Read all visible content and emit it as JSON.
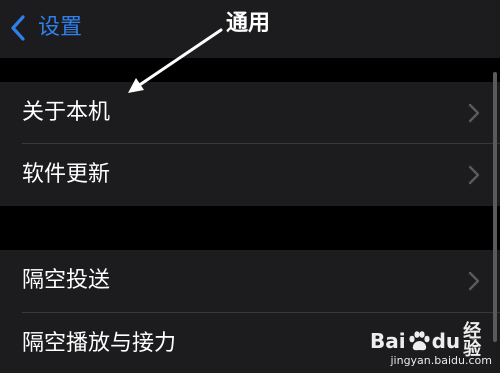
{
  "nav": {
    "back_label": "设置",
    "title": "通用"
  },
  "groups": [
    {
      "items": [
        {
          "label": "关于本机",
          "has_chevron": true
        },
        {
          "label": "软件更新",
          "has_chevron": true
        }
      ]
    },
    {
      "items": [
        {
          "label": "隔空投送",
          "has_chevron": true
        },
        {
          "label": "隔空播放与接力",
          "has_chevron": true
        }
      ]
    }
  ],
  "watermark": {
    "brand_prefix": "Bai",
    "brand_du": "du",
    "brand_suffix": "经验",
    "url": "jingyan.baidu.com"
  },
  "colors": {
    "background": "#000000",
    "cell": "#1c1c1e",
    "accent": "#2f80ed",
    "text": "#ffffff",
    "chevron": "#5a5a5e",
    "separator": "#38383a"
  },
  "icons": {
    "back": "chevron-left-icon",
    "disclosure": "chevron-right-icon",
    "annotation": "arrow-icon",
    "watermark_logo": "paw-icon"
  }
}
